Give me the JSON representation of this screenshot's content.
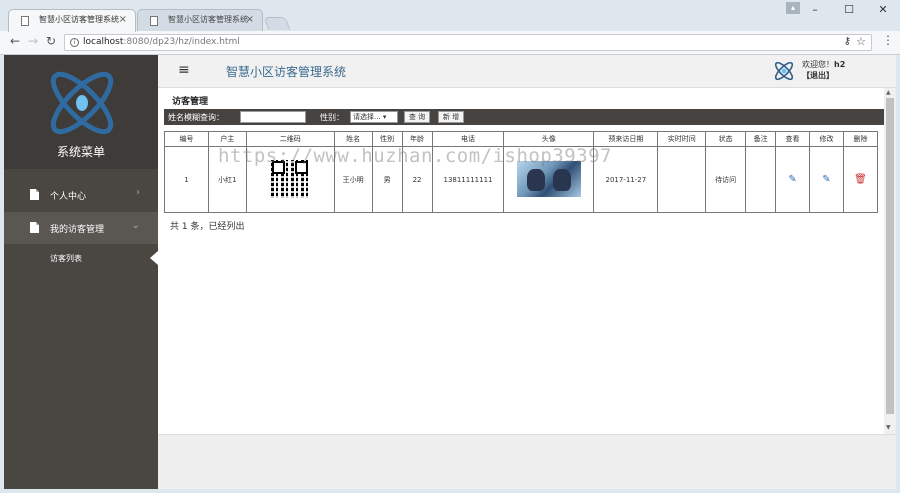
{
  "browser": {
    "tabs": [
      {
        "title": "智慧小区访客管理系统",
        "active": true
      },
      {
        "title": "智慧小区访客管理系统",
        "active": false
      }
    ],
    "close_glyph": "×",
    "url_host": "localhost",
    "url_path": ":8080/dp23/hz/index.html",
    "window_buttons": [
      "–",
      "☐",
      "✕"
    ]
  },
  "sidebar": {
    "brand_title": "系统菜单",
    "items": [
      {
        "label": "个人中心",
        "icon": "doc-icon",
        "chevron": "›"
      },
      {
        "label": "我的访客管理",
        "icon": "doc-icon",
        "chevron": "⌄"
      }
    ],
    "sub_items": [
      {
        "label": "访客列表"
      }
    ]
  },
  "header": {
    "menu_glyph": "≡",
    "title": "智慧小区访客管理系统",
    "welcome_prefix": "欢迎您！",
    "username": "h2",
    "logout": "【退出】"
  },
  "main": {
    "section_title": "访客管理",
    "search": {
      "name_label": "姓名模糊查询：",
      "name_value": "",
      "gender_label": "性别：",
      "gender_selected": "请选择... ▾",
      "query_button": "查 询",
      "add_button": "新 增"
    },
    "table": {
      "headers": [
        "编号",
        "户主",
        "二维码",
        "姓名",
        "性别",
        "年龄",
        "电话",
        "头像",
        "预来访日期",
        "实时时间",
        "状态",
        "备注",
        "查看",
        "修改",
        "删除"
      ],
      "rows": [
        {
          "id": "1",
          "owner": "小红1",
          "name": "王小明",
          "gender": "男",
          "age": "22",
          "phone": "13811111111",
          "visit_date": "2017-11-27",
          "realtime": "",
          "status": "待访问",
          "remark": ""
        }
      ]
    },
    "summary": "共 1 条，已经列出"
  },
  "watermark": "https://www.huzhan.com/ishop39397",
  "colors": {
    "sidebar_bg": "#4a4642",
    "brand_blue": "#3b6b8e",
    "edit_blue": "#2b6fb1",
    "delete_red": "#c9302c"
  }
}
